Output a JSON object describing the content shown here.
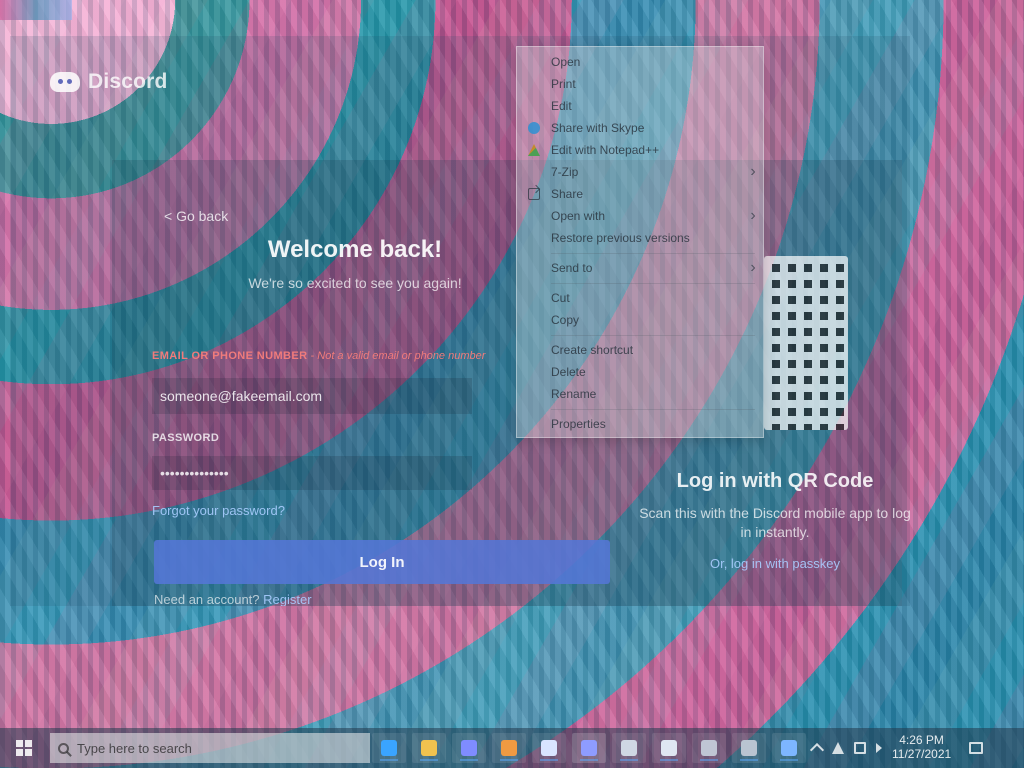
{
  "discord": {
    "brand": "Discord",
    "back_label": "< Go back",
    "title": "Welcome back!",
    "subtitle": "We're so excited to see you again!",
    "email_label": "EMAIL OR PHONE NUMBER",
    "email_error": " - Not a valid email or phone number",
    "email_value": "someone@fakeemail.com",
    "password_label": "PASSWORD",
    "password_value": "••••••••••••••",
    "forgot_password": "Forgot your password?",
    "login_button": "Log In",
    "register_prefix": "Need an account? ",
    "register_link": "Register",
    "qr_title": "Log in with QR Code",
    "qr_description": "Scan this with the Discord mobile app to log in instantly.",
    "qr_alt_link": "Or, log in with passkey"
  },
  "context_menu": {
    "items": [
      {
        "label": "Open",
        "icon": "",
        "submenu": false
      },
      {
        "label": "Print",
        "icon": "",
        "submenu": false
      },
      {
        "label": "Edit",
        "icon": "",
        "submenu": false
      },
      {
        "label": "Share with Skype",
        "icon": "skype-icon",
        "submenu": false
      },
      {
        "label": "Edit with Notepad++",
        "icon": "notepad-icon",
        "submenu": false
      },
      {
        "label": "7-Zip",
        "icon": "",
        "submenu": true
      },
      {
        "label": "Share",
        "icon": "share-icon",
        "submenu": false
      },
      {
        "label": "Open with",
        "icon": "",
        "submenu": true
      },
      {
        "label": "Restore previous versions",
        "icon": "",
        "submenu": false
      },
      {
        "label": "Send to",
        "icon": "",
        "submenu": true
      },
      {
        "label": "Cut",
        "icon": "",
        "submenu": false
      },
      {
        "label": "Copy",
        "icon": "",
        "submenu": false
      },
      {
        "label": "Create shortcut",
        "icon": "",
        "submenu": false
      },
      {
        "label": "Delete",
        "icon": "",
        "submenu": false
      },
      {
        "label": "Rename",
        "icon": "",
        "submenu": false
      },
      {
        "label": "Properties",
        "icon": "",
        "submenu": false
      }
    ]
  },
  "taskbar": {
    "search_placeholder": "Type here to search",
    "apps": [
      {
        "name": "edge",
        "color": "#3aa4ff"
      },
      {
        "name": "file-explorer",
        "color": "#f1c24f"
      },
      {
        "name": "store",
        "color": "#7f8cff"
      },
      {
        "name": "paint",
        "color": "#f09a42"
      },
      {
        "name": "photos",
        "color": "#d9e4ff"
      },
      {
        "name": "discord",
        "color": "#8e9cff"
      },
      {
        "name": "unity",
        "color": "#cfd7e3"
      },
      {
        "name": "notepad",
        "color": "#dfe6f2"
      },
      {
        "name": "terminal",
        "color": "#bfc6d4"
      },
      {
        "name": "settings",
        "color": "#b9c4d1"
      },
      {
        "name": "app-11",
        "color": "#7db6ff"
      }
    ],
    "time": "4:26 PM",
    "date": "11/27/2021"
  }
}
